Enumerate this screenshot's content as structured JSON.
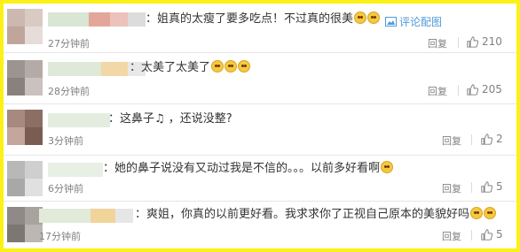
{
  "comments": [
    {
      "text": "：姐真的太瘦了要多吃点！不过真的很美",
      "emojis": [
        "cry-laugh-emoji",
        "cry-laugh-emoji"
      ],
      "time": "27分钟前",
      "reply": "回复",
      "likes": "210",
      "extra": "评论配图"
    },
    {
      "text": "：太美了太美了",
      "emojis": [
        "cry-laugh-emoji",
        "cry-laugh-emoji",
        "cry-laugh-emoji"
      ],
      "time": "28分钟前",
      "reply": "回复",
      "likes": "205"
    },
    {
      "text": "：这鼻子♫ ，还说没整?",
      "time": "3分钟前",
      "reply": "回复",
      "likes": "2"
    },
    {
      "text": "：她的鼻子说没有又动过我是不信的。。。以前多好看啊",
      "emojis": [
        "blush-emoji"
      ],
      "time": "6分钟前",
      "reply": "回复",
      "likes": "5"
    },
    {
      "text": "：爽姐，你真的以前更好看。我求求你了正视自己原本的美貌好吗",
      "emojis": [
        "laugh-emoji",
        "laugh-emoji"
      ],
      "time": "17分钟前",
      "reply": "回复",
      "likes": "5"
    }
  ],
  "colors": {
    "frame": "#fcf116",
    "link": "#4f9bd9",
    "muted": "#808080"
  }
}
